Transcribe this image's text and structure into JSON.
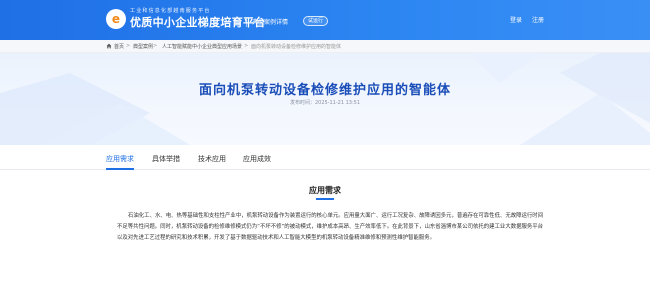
{
  "header": {
    "logo_letter": "e",
    "brand_subtitle": "工业和信息化部越南服务平台",
    "brand_title": "优质中小企业梯度培育平台",
    "section": "典型案例详情",
    "badge": "试运行",
    "login": "登录",
    "register": "注册"
  },
  "breadcrumb": {
    "items": [
      "首页",
      "典型案例",
      "人工智能赋能中小企业典型应用场景",
      "面向机泵转动设备检修维护应用的智能体"
    ],
    "separator": ">"
  },
  "article": {
    "title": "面向机泵转动设备检修维护应用的智能体",
    "date": "发布时间：2025-11-21 13:51"
  },
  "tabs": [
    "应用需求",
    "具体举措",
    "技术应用",
    "应用成效"
  ],
  "active_tab": 0,
  "content": {
    "section_title": "应用需求",
    "paragraph": "石油化工、水、电、热等基础性和支柱性产业中，机泵转动设备作为装置运行的核心单元。应用量大面广、运行工况复杂、故障诱因多元，普遍存在可靠性低、无故障运行时间不足等共性问题。同时，机泵转动设备的检修维修模式仍为“不坏不修”的被动模式，维护成本高昂、生产效率低下。在此背景下，山东省淄博市某公司依托的建工业大数据服务平台以及对先进工艺过程的研究和技术积累，开发了基于数据驱动技术和人工智能大模型的机泵转动设备精准维修和预测性维护智能服务。"
  },
  "colors": {
    "primary": "#1f6fe5",
    "title_blue": "#1a4db8",
    "logo_orange": "#f08a1a"
  }
}
